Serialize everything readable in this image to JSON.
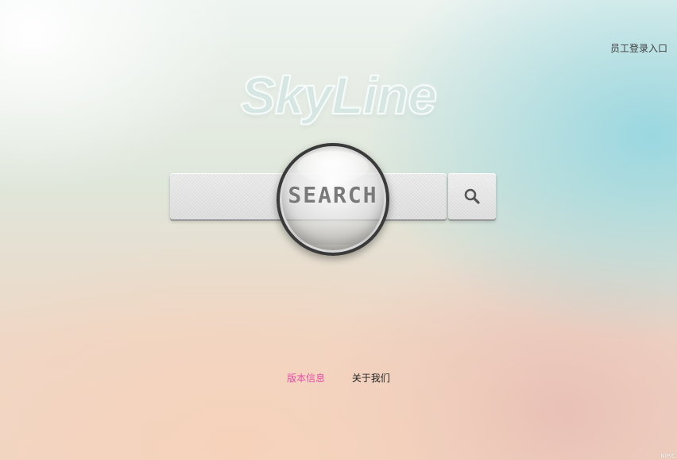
{
  "header": {
    "employee_login_label": "员工登录入口"
  },
  "logo": {
    "text": "SkyLine"
  },
  "search": {
    "input_value": "",
    "button_icon": "search-icon",
    "magnifier_text": "SEARCH"
  },
  "footer": {
    "links": [
      {
        "label": "版本信息",
        "color": "#e64ca8"
      },
      {
        "label": "关于我们",
        "color": "#222222"
      }
    ]
  },
  "watermark": {
    "text": "NIPIC"
  },
  "colors": {
    "text_default": "#3f3f3f",
    "link_accent": "#e64ca8"
  }
}
